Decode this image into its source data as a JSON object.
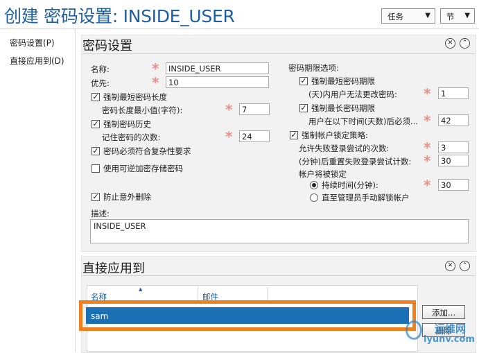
{
  "header": {
    "title": "创建 密码设置: INSIDE_USER",
    "task_dropdown": "任务",
    "section_dropdown": "节"
  },
  "nav": {
    "items": [
      "密码设置(P)",
      "直接应用到(D)"
    ]
  },
  "password_panel": {
    "title": "密码设置",
    "name_label": "名称:",
    "name_value": "INSIDE_USER",
    "precedence_label": "优先:",
    "precedence_value": "10",
    "enforce_min_length": {
      "label": "强制最短密码长度",
      "checked": true
    },
    "min_length_label": "密码长度最小值(字符):",
    "min_length_value": "7",
    "enforce_history": {
      "label": "强制密码历史",
      "checked": true
    },
    "history_label": "记住密码的次数:",
    "history_value": "24",
    "complexity": {
      "label": "密码必须符合复杂性要求",
      "checked": true
    },
    "reversible": {
      "label": "使用可逆加密存储密码",
      "checked": false
    },
    "protect_delete": {
      "label": "防止意外删除",
      "checked": true
    },
    "description_label": "描述:",
    "description_value": "INSIDE_USER",
    "age_options_label": "密码期限选项:",
    "enforce_min_age": {
      "label": "强制最短密码期限",
      "checked": true
    },
    "min_age_label": "(天)内用户无法更改密码:",
    "min_age_value": "1",
    "enforce_max_age": {
      "label": "强制最长密码期限",
      "checked": true
    },
    "max_age_label": "用户在以下时间(天数)后必须...",
    "max_age_value": "42",
    "enforce_lockout": {
      "label": "强制帐户锁定策略:",
      "checked": true
    },
    "failed_attempts_label": "允许失败登录尝试的次数:",
    "failed_attempts_value": "3",
    "reset_label": "(分钟)后重置失败登录尝试计数:",
    "reset_value": "30",
    "locked_label": "帐户将被锁定",
    "duration_label": "持续时间(分钟):",
    "duration_value": "30",
    "duration_selected": true,
    "manual_unlock_label": "直至管理员手动解锁帐户"
  },
  "apply_panel": {
    "title": "直接应用到",
    "columns": [
      "名称",
      "邮件"
    ],
    "rows": [
      {
        "name": "sam",
        "mail": ""
      }
    ],
    "add_button": "添加...",
    "remove_button": "删除"
  },
  "watermark": {
    "line1": "运维网",
    "line2": "iyunv.com"
  },
  "colors": {
    "title_blue": "#1f5fa3",
    "selection_blue": "#1a6fb5",
    "highlight_orange": "#f0801c",
    "required_star": "#e4938d"
  }
}
